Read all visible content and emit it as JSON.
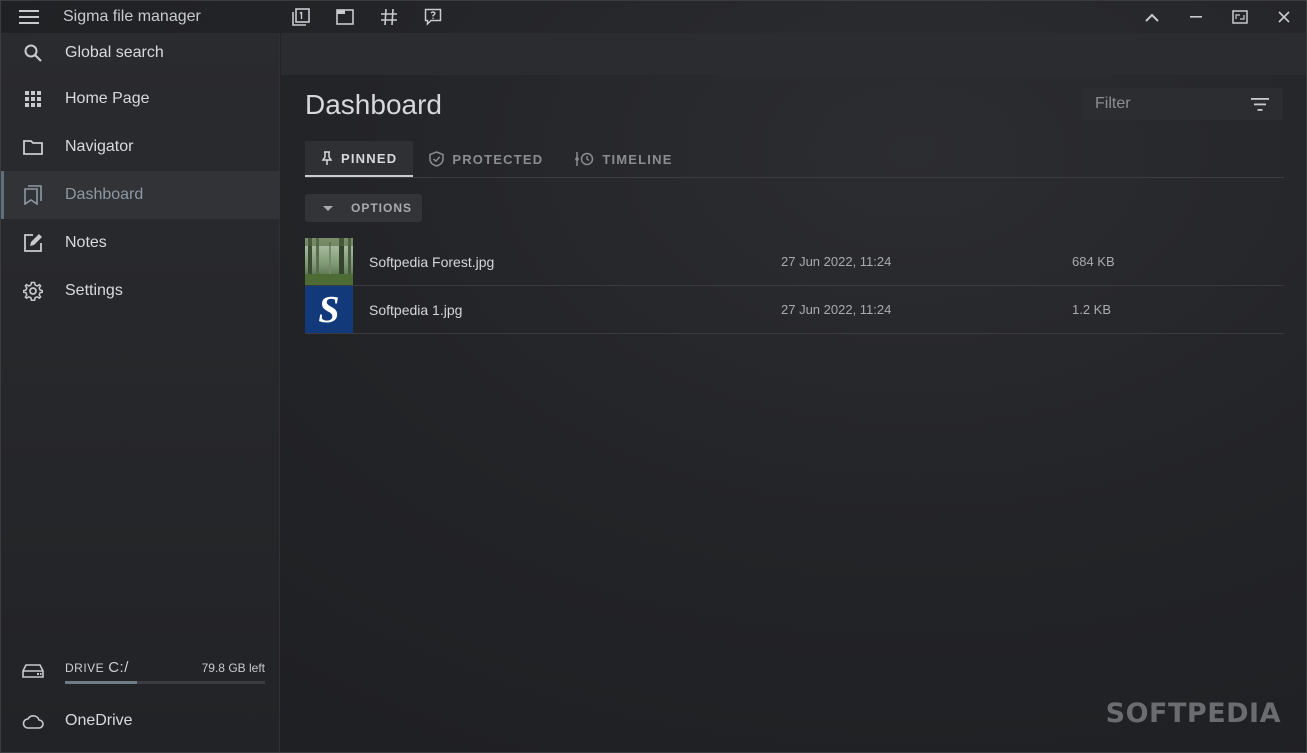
{
  "app": {
    "title": "Sigma file manager"
  },
  "sidebar": {
    "items": [
      {
        "label": "Global search",
        "icon": "search-icon"
      },
      {
        "label": "Home Page",
        "icon": "grid-icon"
      },
      {
        "label": "Navigator",
        "icon": "folder-icon"
      },
      {
        "label": "Dashboard",
        "icon": "bookmarks-icon",
        "active": true
      },
      {
        "label": "Notes",
        "icon": "edit-note-icon"
      },
      {
        "label": "Settings",
        "icon": "gear-icon"
      }
    ],
    "drive": {
      "label": "DRIVE",
      "path": "C:/",
      "free": "79.8 GB left",
      "used_fraction": 0.36
    },
    "onedrive": {
      "label": "OneDrive"
    }
  },
  "main": {
    "title": "Dashboard",
    "filter": {
      "placeholder": "Filter"
    },
    "tabs": [
      {
        "label": "PINNED",
        "active": true
      },
      {
        "label": "PROTECTED"
      },
      {
        "label": "TIMELINE"
      }
    ],
    "options_label": "OPTIONS",
    "files": [
      {
        "name": "Softpedia Forest.jpg",
        "date": "27 Jun 2022, 11:24",
        "size": "684 KB",
        "thumb": "forest"
      },
      {
        "name": "Softpedia 1.jpg",
        "date": "27 Jun 2022, 11:24",
        "size": "1.2 KB",
        "thumb": "s-logo"
      }
    ]
  },
  "watermark": "SOFTPEDIA",
  "colors": {
    "accent": "#5f6f7c",
    "background": "#232427",
    "sidebar_active": "#323337"
  }
}
